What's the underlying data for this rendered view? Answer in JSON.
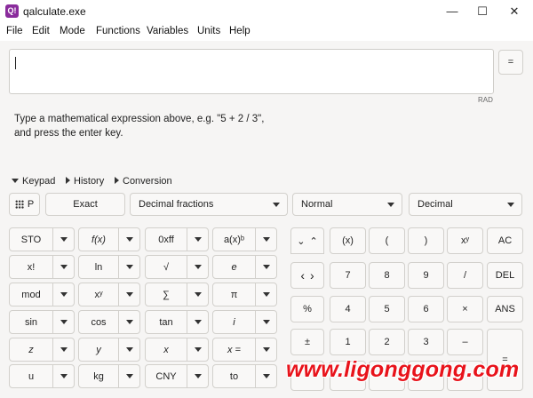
{
  "window": {
    "title": "qalculate.exe",
    "app_icon": "Q!",
    "minimize": "—",
    "maximize": "☐",
    "close": "✕"
  },
  "menu": [
    "File",
    "Edit",
    "Mode",
    "Functions",
    "Variables",
    "Units",
    "Help"
  ],
  "expression": {
    "value": "",
    "equals_label": "=",
    "angle_unit": "RAD"
  },
  "hint": {
    "line1": "Type a mathematical expression above, e.g. \"5 + 2 / 3\",",
    "line2": "and press the enter key."
  },
  "tabs": [
    {
      "label": "Keypad",
      "expanded": true
    },
    {
      "label": "History",
      "expanded": false
    },
    {
      "label": "Conversion",
      "expanded": false
    }
  ],
  "toolbar": {
    "keypad_toggle": "P",
    "exact_label": "Exact",
    "fraction_mode": "Decimal fractions",
    "display_mode": "Normal",
    "base_mode": "Decimal"
  },
  "left_keys": [
    [
      "STO",
      "f(x)",
      "0xff",
      "a(x)ᵇ"
    ],
    [
      "x!",
      "ln",
      "√",
      "e"
    ],
    [
      "mod",
      "xʸ",
      "∑",
      "π"
    ],
    [
      "sin",
      "cos",
      "tan",
      "i"
    ],
    [
      "z",
      "y",
      "x",
      "x ="
    ],
    [
      "u",
      "kg",
      "CNY",
      "to"
    ]
  ],
  "right_keys": {
    "nav": [
      "⌄",
      "⌃",
      "‹",
      "›",
      "%",
      "±"
    ],
    "grid": [
      [
        "(x)",
        "(",
        ")",
        "xʸ",
        "AC"
      ],
      [
        "7",
        "8",
        "9",
        "/",
        "DEL"
      ],
      [
        "4",
        "5",
        "6",
        "×",
        "ANS"
      ],
      [
        "1",
        "2",
        "3",
        "–",
        "="
      ]
    ]
  },
  "watermark": "www.ligonggong.com",
  "colors": {
    "accent": "#8a2c9c",
    "watermark": "#e8131b"
  }
}
